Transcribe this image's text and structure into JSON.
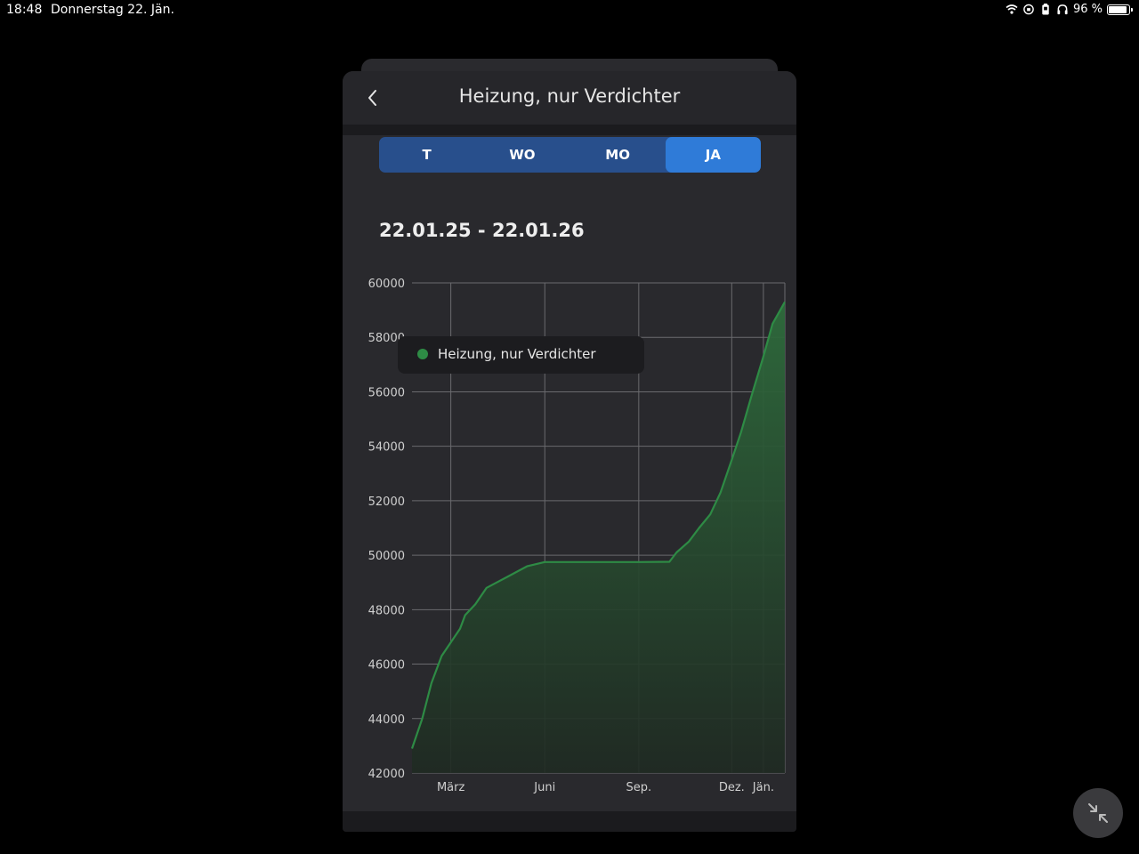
{
  "status_bar": {
    "time": "18:48",
    "date": "Donnerstag 22. Jän.",
    "battery_text": "96 %",
    "battery_level": 0.96,
    "icons": [
      "wifi-icon",
      "screen-lock-icon",
      "battery-saver-icon",
      "headphones-icon",
      "battery-icon"
    ]
  },
  "header": {
    "title": "Heizung, nur Verdichter",
    "back_icon": "chevron-left-icon"
  },
  "tabs": [
    {
      "label": "T",
      "active": false
    },
    {
      "label": "WO",
      "active": false
    },
    {
      "label": "MO",
      "active": false
    },
    {
      "label": "JA",
      "active": true
    }
  ],
  "range_label": "22.01.25 - 22.01.26",
  "legend": {
    "label": "Heizung, nur Verdichter",
    "color": "#2e8b45"
  },
  "chart_data": {
    "type": "area",
    "ylim": [
      42000,
      60000
    ],
    "y_ticks": [
      "60000",
      "58000",
      "56000",
      "54000",
      "52000",
      "50000",
      "48000",
      "46000",
      "44000",
      "42000"
    ],
    "y_tick_values": [
      60000,
      58000,
      56000,
      54000,
      52000,
      50000,
      48000,
      46000,
      44000,
      42000
    ],
    "x_ticks": [
      "März",
      "Juni",
      "Sep.",
      "Dez.",
      "Jän."
    ],
    "x_tick_dates": [
      "2025-03-01",
      "2025-06-01",
      "2025-09-01",
      "2025-12-01",
      "2026-01-01"
    ],
    "xlim": [
      "2025-01-22",
      "2026-01-22"
    ],
    "grid": true,
    "legend_position": "top-left",
    "series": [
      {
        "name": "Heizung, nur Verdichter",
        "color": "#2e8b45",
        "points": [
          [
            "2025-01-22",
            42900
          ],
          [
            "2025-02-01",
            44000
          ],
          [
            "2025-02-10",
            45300
          ],
          [
            "2025-02-20",
            46300
          ],
          [
            "2025-03-01",
            46800
          ],
          [
            "2025-03-10",
            47300
          ],
          [
            "2025-03-15",
            47800
          ],
          [
            "2025-03-25",
            48200
          ],
          [
            "2025-04-05",
            48800
          ],
          [
            "2025-04-15",
            49000
          ],
          [
            "2025-04-25",
            49200
          ],
          [
            "2025-05-05",
            49400
          ],
          [
            "2025-05-15",
            49600
          ],
          [
            "2025-06-01",
            49750
          ],
          [
            "2025-07-01",
            49750
          ],
          [
            "2025-08-01",
            49750
          ],
          [
            "2025-09-01",
            49750
          ],
          [
            "2025-10-01",
            49760
          ],
          [
            "2025-10-08",
            50100
          ],
          [
            "2025-10-20",
            50500
          ],
          [
            "2025-10-30",
            51000
          ],
          [
            "2025-11-10",
            51500
          ],
          [
            "2025-11-20",
            52300
          ],
          [
            "2025-12-01",
            53500
          ],
          [
            "2025-12-10",
            54500
          ],
          [
            "2025-12-20",
            55800
          ],
          [
            "2026-01-01",
            57300
          ],
          [
            "2026-01-10",
            58500
          ],
          [
            "2026-01-22",
            59300
          ]
        ]
      }
    ]
  },
  "fab": {
    "icon": "collapse-arrows-icon"
  }
}
